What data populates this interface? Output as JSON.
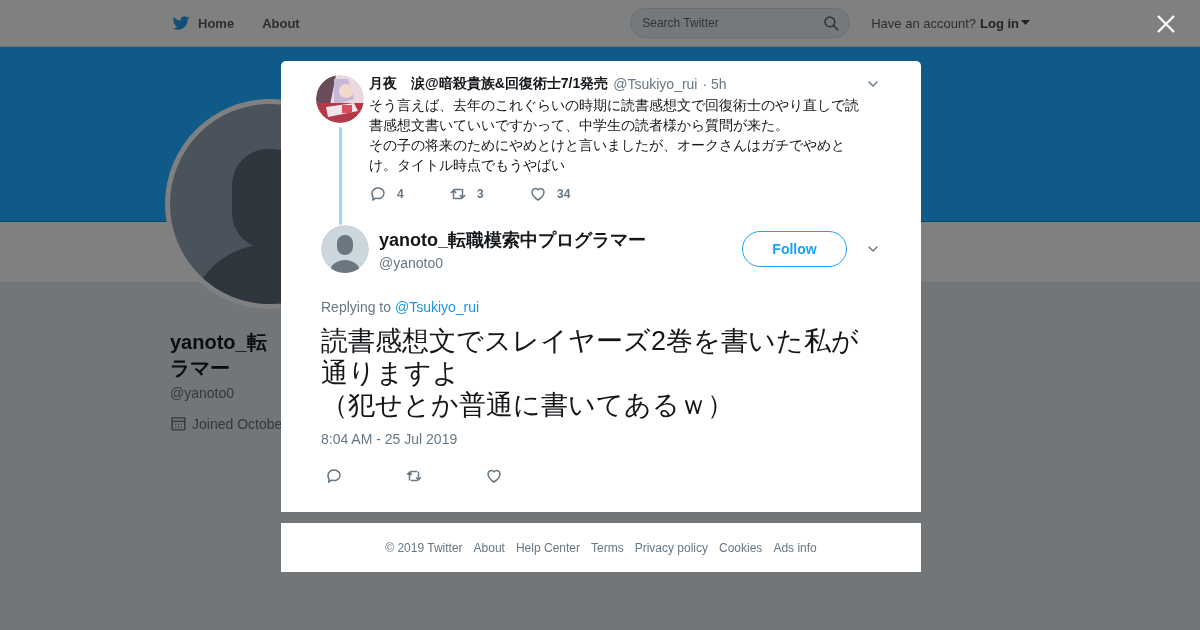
{
  "nav": {
    "items": [
      {
        "label": "Home"
      },
      {
        "label": "About"
      }
    ],
    "search": {
      "placeholder": "Search Twitter"
    },
    "account_prompt": "Have an account?",
    "login": "Log in"
  },
  "profile": {
    "name_lines": [
      "yanoto_転",
      "ラマー"
    ],
    "handle": "@yanoto0",
    "joined": "Joined Octobe"
  },
  "parent_tweet": {
    "name": "月夜　涙@暗殺貴族&回復術士7/1発売",
    "handle": "@Tsukiyo_rui",
    "time": "· 5h",
    "paragraphs": [
      "そう言えば、去年のこれぐらいの時期に読書感想文で回復術士のやり直しで読書感想文書いていいですかって、中学生の読者様から質問が来た。",
      "その子の将来のためにやめとけと言いましたが、オークさんはガチでやめとけ。タイトル時点でもうやばい"
    ],
    "replies": "4",
    "retweets": "3",
    "likes": "34"
  },
  "tweet": {
    "name": "yanoto_転職模索中プログラマー",
    "handle": "@yanoto0",
    "follow": "Follow",
    "replying_label": "Replying to",
    "replying_to": "@Tsukiyo_rui",
    "lines": [
      "読書感想文でスレイヤーズ2巻を書いた私が",
      "通りますよ",
      "（犯せとか普通に書いてあるｗ）"
    ],
    "timestamp": "8:04 AM - 25 Jul 2019"
  },
  "footer": [
    "© 2019 Twitter",
    "About",
    "Help Center",
    "Terms",
    "Privacy policy",
    "Cookies",
    "Ads info"
  ]
}
